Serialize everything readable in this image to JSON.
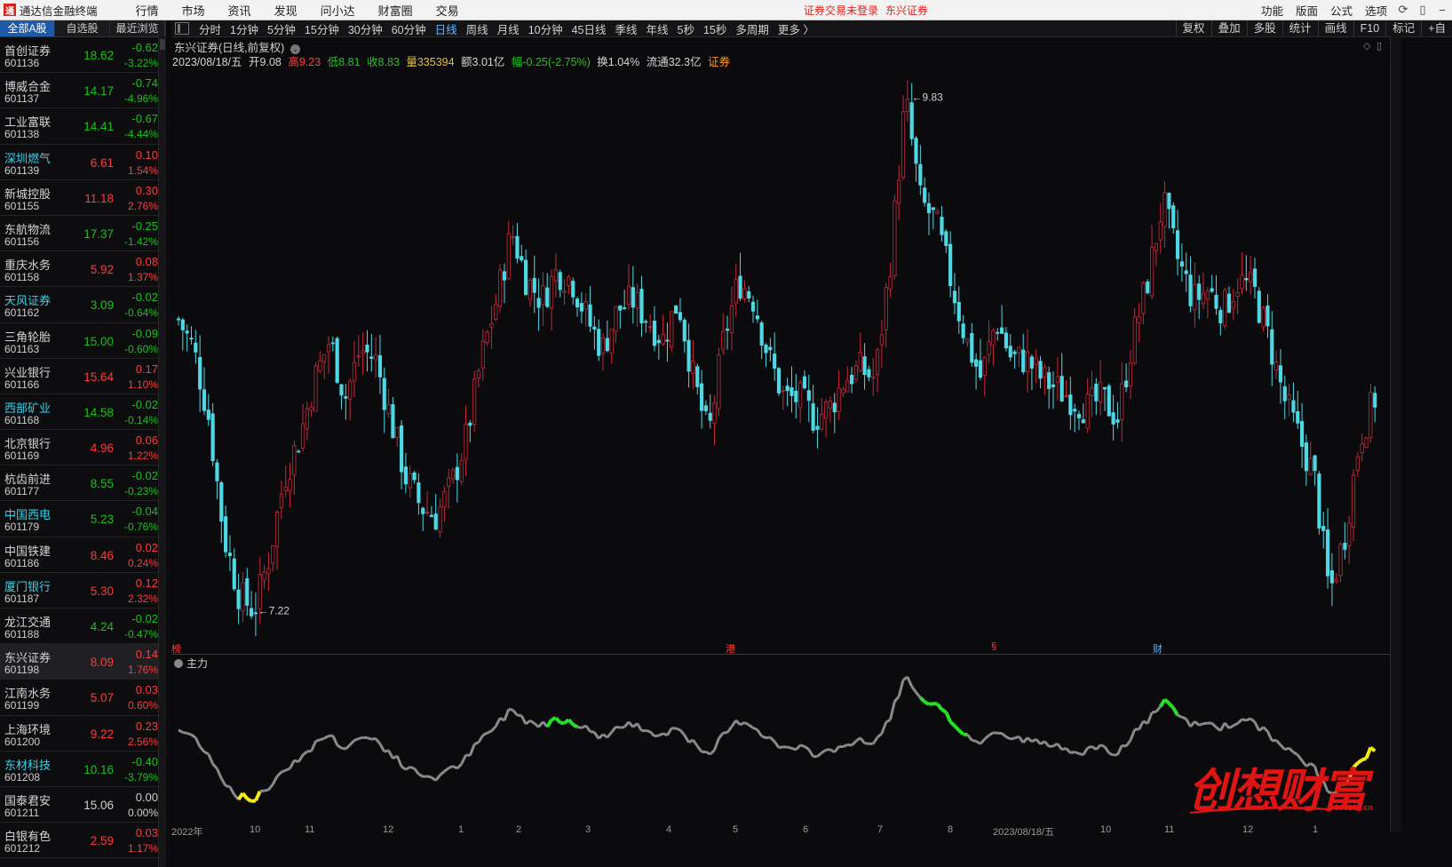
{
  "app": {
    "name": "通达信金融终端",
    "logo": "通"
  },
  "menu": [
    "行情",
    "市场",
    "资讯",
    "发现",
    "问小达",
    "财富圈",
    "交易"
  ],
  "login_notice": [
    "证券交易未登录",
    "东兴证券"
  ],
  "menu_right": [
    "功能",
    "版面",
    "公式",
    "选项"
  ],
  "window_icons": [
    "refresh-icon",
    "phone-icon",
    "minimize-icon"
  ],
  "list_tabs": [
    "全部A股",
    "自选股",
    "最近浏览"
  ],
  "stocks": [
    {
      "name": "首创证券",
      "code": "601136",
      "price": "18.62",
      "chg": "-0.62",
      "pct": "-3.22%",
      "dir": "down",
      "cyan": false
    },
    {
      "name": "博威合金",
      "code": "601137",
      "price": "14.17",
      "chg": "-0.74",
      "pct": "-4.96%",
      "dir": "down",
      "cyan": false
    },
    {
      "name": "工业富联",
      "code": "601138",
      "price": "14.41",
      "chg": "-0.67",
      "pct": "-4.44%",
      "dir": "down",
      "cyan": false
    },
    {
      "name": "深圳燃气",
      "code": "601139",
      "price": "6.61",
      "chg": "0.10",
      "pct": "1.54%",
      "dir": "up",
      "cyan": true
    },
    {
      "name": "新城控股",
      "code": "601155",
      "price": "11.18",
      "chg": "0.30",
      "pct": "2.76%",
      "dir": "up",
      "cyan": false
    },
    {
      "name": "东航物流",
      "code": "601156",
      "price": "17.37",
      "chg": "-0.25",
      "pct": "-1.42%",
      "dir": "down",
      "cyan": false
    },
    {
      "name": "重庆水务",
      "code": "601158",
      "price": "5.92",
      "chg": "0.08",
      "pct": "1.37%",
      "dir": "up",
      "cyan": false
    },
    {
      "name": "天风证券",
      "code": "601162",
      "price": "3.09",
      "chg": "-0.02",
      "pct": "-0.64%",
      "dir": "down",
      "cyan": true
    },
    {
      "name": "三角轮胎",
      "code": "601163",
      "price": "15.00",
      "chg": "-0.09",
      "pct": "-0.60%",
      "dir": "down",
      "cyan": false
    },
    {
      "name": "兴业银行",
      "code": "601166",
      "price": "15.64",
      "chg": "0.17",
      "pct": "1.10%",
      "dir": "up",
      "cyan": false
    },
    {
      "name": "西部矿业",
      "code": "601168",
      "price": "14.58",
      "chg": "-0.02",
      "pct": "-0.14%",
      "dir": "down",
      "cyan": true
    },
    {
      "name": "北京银行",
      "code": "601169",
      "price": "4.96",
      "chg": "0.06",
      "pct": "1.22%",
      "dir": "up",
      "cyan": false
    },
    {
      "name": "杭齿前进",
      "code": "601177",
      "price": "8.55",
      "chg": "-0.02",
      "pct": "-0.23%",
      "dir": "down",
      "cyan": false
    },
    {
      "name": "中国西电",
      "code": "601179",
      "price": "5.23",
      "chg": "-0.04",
      "pct": "-0.76%",
      "dir": "down",
      "cyan": true
    },
    {
      "name": "中国铁建",
      "code": "601186",
      "price": "8.46",
      "chg": "0.02",
      "pct": "0.24%",
      "dir": "up",
      "cyan": false
    },
    {
      "name": "厦门银行",
      "code": "601187",
      "price": "5.30",
      "chg": "0.12",
      "pct": "2.32%",
      "dir": "up",
      "cyan": true
    },
    {
      "name": "龙江交通",
      "code": "601188",
      "price": "4.24",
      "chg": "-0.02",
      "pct": "-0.47%",
      "dir": "down",
      "cyan": false
    },
    {
      "name": "东兴证券",
      "code": "601198",
      "price": "8.09",
      "chg": "0.14",
      "pct": "1.76%",
      "dir": "up",
      "cyan": false,
      "selected": true
    },
    {
      "name": "江南水务",
      "code": "601199",
      "price": "5.07",
      "chg": "0.03",
      "pct": "0.60%",
      "dir": "up",
      "cyan": false
    },
    {
      "name": "上海环境",
      "code": "601200",
      "price": "9.22",
      "chg": "0.23",
      "pct": "2.56%",
      "dir": "up",
      "cyan": false
    },
    {
      "name": "东材科技",
      "code": "601208",
      "price": "10.16",
      "chg": "-0.40",
      "pct": "-3.79%",
      "dir": "down",
      "cyan": true
    },
    {
      "name": "国泰君安",
      "code": "601211",
      "price": "15.06",
      "chg": "0.00",
      "pct": "0.00%",
      "dir": "flat",
      "cyan": false
    },
    {
      "name": "白银有色",
      "code": "601212",
      "price": "2.59",
      "chg": "0.03",
      "pct": "1.17%",
      "dir": "up",
      "cyan": false
    }
  ],
  "periods": [
    "分时",
    "1分钟",
    "5分钟",
    "15分钟",
    "30分钟",
    "60分钟",
    "日线",
    "周线",
    "月线",
    "10分钟",
    "45日线",
    "季线",
    "年线",
    "5秒",
    "15秒",
    "多周期",
    "更多 〉"
  ],
  "active_period": "日线",
  "tools_right": [
    "复权",
    "叠加",
    "多股",
    "统计",
    "画线",
    "F10",
    "标记",
    "+自"
  ],
  "chart": {
    "title": "东兴证券(日线,前复权)",
    "date": "2023/08/18/五",
    "open": "开9.08",
    "high": "高9.23",
    "low": "低8.81",
    "close": "收8.83",
    "volume": "量335394",
    "amount": "额3.01亿",
    "change": "幅-0.25(-2.75%)",
    "turnover": "换1.04%",
    "float_cap": "流通32.3亿",
    "sector": "证券",
    "max_label": "9.83",
    "min_label": "7.22",
    "events": [
      {
        "text": "榜"
      },
      {
        "text": "港"
      },
      {
        "text": "§"
      },
      {
        "text": "财"
      }
    ],
    "sub_indicator": "主力",
    "date_ticks": [
      "2022年",
      "10",
      "11",
      "12",
      "1",
      "2",
      "3",
      "4",
      "5",
      "6",
      "7",
      "8",
      "2023/08/18/五",
      "10",
      "11",
      "12",
      "1"
    ]
  },
  "chart_data": {
    "type": "candlestick",
    "title": "东兴证券(日线,前复权)",
    "ylim": [
      7.0,
      10.0
    ],
    "labeled_high": 9.83,
    "labeled_low": 7.22,
    "last": {
      "date": "2023/08/18",
      "open": 9.08,
      "high": 9.23,
      "low": 8.81,
      "close": 8.83
    },
    "path": [
      8.7,
      8.55,
      8.2,
      7.6,
      7.3,
      7.22,
      7.5,
      7.9,
      8.1,
      8.4,
      8.6,
      8.3,
      8.55,
      8.5,
      8.2,
      7.9,
      7.75,
      7.7,
      7.85,
      8.1,
      8.5,
      8.8,
      9.15,
      8.9,
      8.8,
      8.95,
      8.9,
      8.7,
      8.55,
      8.75,
      8.8,
      8.7,
      8.6,
      8.8,
      8.4,
      8.1,
      8.6,
      8.9,
      8.8,
      8.5,
      8.3,
      8.3,
      8.2,
      8.25,
      8.4,
      8.45,
      8.4,
      9.0,
      9.83,
      9.3,
      9.2,
      8.9,
      8.6,
      8.4,
      8.7,
      8.5,
      8.5,
      8.4,
      8.35,
      8.3,
      8.25,
      8.3,
      8.2,
      8.6,
      8.9,
      9.3,
      9.0,
      8.8,
      8.85,
      8.75,
      8.9,
      8.85,
      8.6,
      8.3,
      8.1,
      7.9,
      7.3,
      7.6,
      8.1,
      8.3
    ]
  },
  "sub_chart_data": {
    "type": "line",
    "name": "主力",
    "colors": {
      "base": "#8a8a8a",
      "strong": "#27e027",
      "weak": "#f4ec12"
    }
  },
  "watermark": {
    "text": "创想财富",
    "url": "995168.cn"
  },
  "colors": {
    "up": "#ff3b3b",
    "down": "#19c219",
    "candle_up": "#c9283a",
    "candle_down": "#4fd8e4",
    "accent": "#1e5aa8"
  }
}
